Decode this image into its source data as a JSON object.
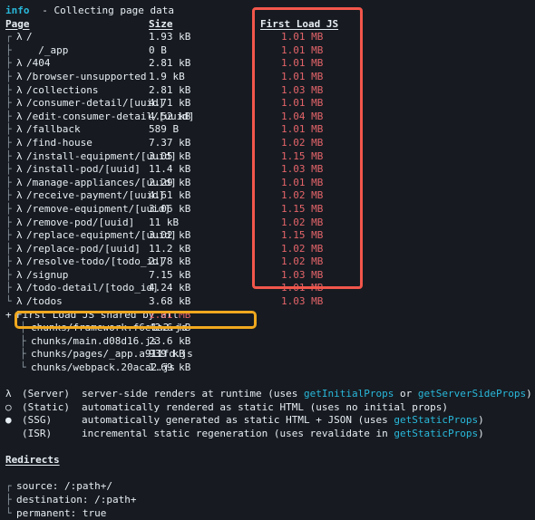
{
  "terminal": {
    "bg": "#171b21",
    "fg": "#d8dee4",
    "info_label": "info",
    "info_text": "  - Collecting page data"
  },
  "table": {
    "headers": {
      "page": "Page",
      "size": "Size",
      "first_load": "First Load JS"
    },
    "rows": [
      {
        "tree": "┌",
        "sym": "λ",
        "page": "/",
        "size": "1.93 kB",
        "fl": "1.01 MB"
      },
      {
        "tree": "├",
        "sym": "",
        "page": "  /_app",
        "size": "0 B",
        "fl": "1.01 MB"
      },
      {
        "tree": "├",
        "sym": "λ",
        "page": "/404",
        "size": "2.81 kB",
        "fl": "1.01 MB"
      },
      {
        "tree": "├",
        "sym": "λ",
        "page": "/browser-unsupported",
        "size": "1.9 kB",
        "fl": "1.01 MB"
      },
      {
        "tree": "├",
        "sym": "λ",
        "page": "/collections",
        "size": "2.81 kB",
        "fl": "1.03 MB"
      },
      {
        "tree": "├",
        "sym": "λ",
        "page": "/consumer-detail/[uuid]",
        "size": "4.71 kB",
        "fl": "1.01 MB"
      },
      {
        "tree": "├",
        "sym": "λ",
        "page": "/edit-consumer-detail/[uuid]",
        "size": "4.52 kB",
        "fl": "1.04 MB"
      },
      {
        "tree": "├",
        "sym": "λ",
        "page": "/fallback",
        "size": "589 B",
        "fl": "1.01 MB"
      },
      {
        "tree": "├",
        "sym": "λ",
        "page": "/find-house",
        "size": "7.37 kB",
        "fl": "1.02 MB"
      },
      {
        "tree": "├",
        "sym": "λ",
        "page": "/install-equipment/[uuid]",
        "size": "3.05 kB",
        "fl": "1.15 MB"
      },
      {
        "tree": "├",
        "sym": "λ",
        "page": "/install-pod/[uuid]",
        "size": "11.4 kB",
        "fl": "1.03 MB"
      },
      {
        "tree": "├",
        "sym": "λ",
        "page": "/manage-appliances/[uuid]",
        "size": "2.29 kB",
        "fl": "1.01 MB"
      },
      {
        "tree": "├",
        "sym": "λ",
        "page": "/receive-payment/[uuid]",
        "size": "4.61 kB",
        "fl": "1.02 MB"
      },
      {
        "tree": "├",
        "sym": "λ",
        "page": "/remove-equipment/[uuid]",
        "size": "3.06 kB",
        "fl": "1.15 MB"
      },
      {
        "tree": "├",
        "sym": "λ",
        "page": "/remove-pod/[uuid]",
        "size": "11 kB",
        "fl": "1.02 MB"
      },
      {
        "tree": "├",
        "sym": "λ",
        "page": "/replace-equipment/[uuid]",
        "size": "3.02 kB",
        "fl": "1.15 MB"
      },
      {
        "tree": "├",
        "sym": "λ",
        "page": "/replace-pod/[uuid]",
        "size": "11.2 kB",
        "fl": "1.02 MB"
      },
      {
        "tree": "├",
        "sym": "λ",
        "page": "/resolve-todo/[todo_id]",
        "size": "2.78 kB",
        "fl": "1.02 MB"
      },
      {
        "tree": "├",
        "sym": "λ",
        "page": "/signup",
        "size": "7.15 kB",
        "fl": "1.03 MB"
      },
      {
        "tree": "├",
        "sym": "λ",
        "page": "/todo-detail/[todo_id]",
        "size": "4.24 kB",
        "fl": "1.01 MB"
      },
      {
        "tree": "└",
        "sym": "λ",
        "page": "/todos",
        "size": "3.68 kB",
        "fl": "1.03 MB"
      }
    ]
  },
  "shared": {
    "marker": "+",
    "label": "First Load JS shared by all",
    "size": "1.01 MB",
    "chunks": [
      {
        "tree": "├",
        "name": "chunks/framework.f6e1a2.js",
        "size": "42.6 kB"
      },
      {
        "tree": "├",
        "name": "chunks/main.d08d16.js",
        "size": "23.6 kB"
      },
      {
        "tree": "├",
        "name": "chunks/pages/_app.a911fd.js",
        "size": "939 kB"
      },
      {
        "tree": "└",
        "name": "chunks/webpack.20aca2.js",
        "size": "1.69 kB"
      }
    ]
  },
  "legend": [
    {
      "symbol": "λ",
      "kind": "(Server)",
      "parts": [
        {
          "t": "server-side renders at runtime (uses ",
          "c": "white"
        },
        {
          "t": "getInitialProps",
          "c": "cyan"
        },
        {
          "t": " or ",
          "c": "white"
        },
        {
          "t": "getServerSideProps",
          "c": "cyan"
        },
        {
          "t": ")",
          "c": "white"
        }
      ]
    },
    {
      "symbol": "○",
      "kind": "(Static)",
      "parts": [
        {
          "t": "automatically rendered as static HTML (uses no initial props)",
          "c": "white"
        }
      ]
    },
    {
      "symbol": "●",
      "kind": "(SSG)",
      "parts": [
        {
          "t": "automatically generated as static HTML + JSON (uses ",
          "c": "white"
        },
        {
          "t": "getStaticProps",
          "c": "cyan"
        },
        {
          "t": ")",
          "c": "white"
        }
      ]
    },
    {
      "symbol": "",
      "kind": "(ISR)",
      "parts": [
        {
          "t": "incremental static regeneration (uses revalidate in ",
          "c": "white"
        },
        {
          "t": "getStaticProps",
          "c": "cyan"
        },
        {
          "t": ")",
          "c": "white"
        }
      ]
    }
  ],
  "redirects": {
    "title": "Redirects",
    "rows": [
      {
        "tree": "┌",
        "text": "source: /:path+/"
      },
      {
        "tree": "├",
        "text": "destination: /:path+"
      },
      {
        "tree": "└",
        "text": "permanent: true"
      }
    ]
  },
  "annotations": {
    "first_load_box_color": "#f2564b",
    "app_chunk_box_color": "#f0a81e"
  }
}
